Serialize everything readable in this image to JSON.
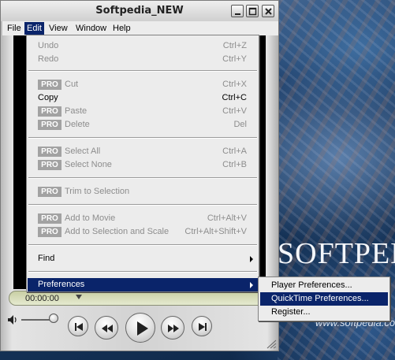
{
  "window": {
    "title": "Softpedia_NEW"
  },
  "menubar": {
    "items": [
      "File",
      "Edit",
      "View",
      "Window",
      "Help"
    ],
    "active": "Edit"
  },
  "edit_menu": {
    "items": [
      {
        "label": "Undo",
        "shortcut": "Ctrl+Z",
        "enabled": false,
        "pro": false
      },
      {
        "label": "Redo",
        "shortcut": "Ctrl+Y",
        "enabled": false,
        "pro": false
      },
      {
        "label": "Cut",
        "shortcut": "Ctrl+X",
        "enabled": false,
        "pro": true
      },
      {
        "label": "Copy",
        "shortcut": "Ctrl+C",
        "enabled": true,
        "pro": false
      },
      {
        "label": "Paste",
        "shortcut": "Ctrl+V",
        "enabled": false,
        "pro": true
      },
      {
        "label": "Delete",
        "shortcut": "Del",
        "enabled": false,
        "pro": true
      },
      {
        "label": "Select All",
        "shortcut": "Ctrl+A",
        "enabled": false,
        "pro": true
      },
      {
        "label": "Select None",
        "shortcut": "Ctrl+B",
        "enabled": false,
        "pro": true
      },
      {
        "label": "Trim to Selection",
        "shortcut": "",
        "enabled": false,
        "pro": true
      },
      {
        "label": "Add to Movie",
        "shortcut": "Ctrl+Alt+V",
        "enabled": false,
        "pro": true
      },
      {
        "label": "Add to Selection and Scale",
        "shortcut": "Ctrl+Alt+Shift+V",
        "enabled": false,
        "pro": true
      },
      {
        "label": "Find",
        "shortcut": "",
        "enabled": true,
        "pro": false,
        "submenu": true
      },
      {
        "label": "Preferences",
        "shortcut": "",
        "enabled": true,
        "pro": false,
        "submenu": true,
        "highlighted": true
      }
    ],
    "pro_badge": "PRO"
  },
  "preferences_submenu": {
    "items": [
      {
        "label": "Player Preferences...",
        "highlighted": false
      },
      {
        "label": "QuickTime Preferences...",
        "highlighted": true
      },
      {
        "label": "Register...",
        "highlighted": false
      }
    ]
  },
  "player": {
    "timecode": "00:00:00"
  },
  "desktop": {
    "brand": "SOFTPEDIA",
    "url": "www.softpedia.com"
  },
  "colors": {
    "menu_highlight": "#0a246a",
    "menu_bg": "#ececec",
    "pro_badge": "#a2a2a2",
    "disabled_text": "#8d8d8d"
  }
}
